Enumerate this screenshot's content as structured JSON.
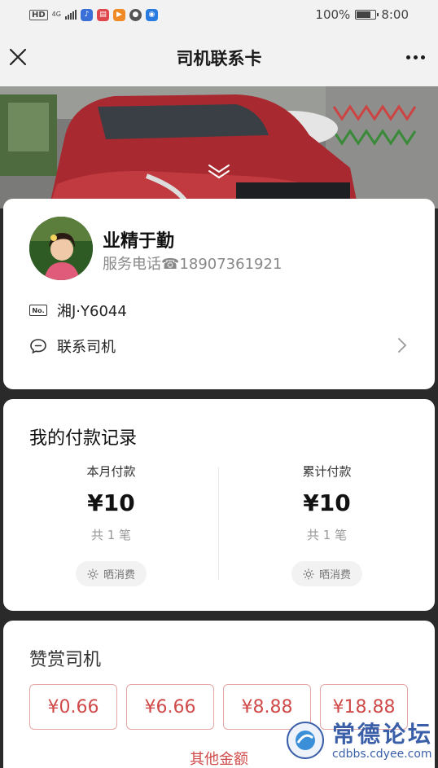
{
  "status_bar": {
    "hd": "HD",
    "network": "4G",
    "battery_percent": "100%",
    "time": "8:00"
  },
  "navbar": {
    "title": "司机联系卡"
  },
  "driver": {
    "name": "业精于勤",
    "phone": "服务电话☎18907361921",
    "plate_icon_label": "No.",
    "plate": "湘J·Y6044",
    "contact_label": "联系司机"
  },
  "payments": {
    "title": "我的付款记录",
    "month": {
      "label": "本月付款",
      "amount": "¥10",
      "count": "共 1 笔",
      "share": "晒消费"
    },
    "total": {
      "label": "累计付款",
      "amount": "¥10",
      "count": "共 1 笔",
      "share": "晒消费"
    }
  },
  "reward": {
    "title": "赞赏司机",
    "amounts": [
      "¥0.66",
      "¥6.66",
      "¥8.88",
      "¥18.88"
    ],
    "other": "其他金额"
  },
  "watermark": {
    "text": "常德论坛",
    "url": "cdbbs.cdyee.com"
  },
  "colors": {
    "accent": "#d04a4a",
    "accent_border": "#e5a6a6",
    "background": "#2a2a2a",
    "watermark": "#3a5fa8"
  }
}
